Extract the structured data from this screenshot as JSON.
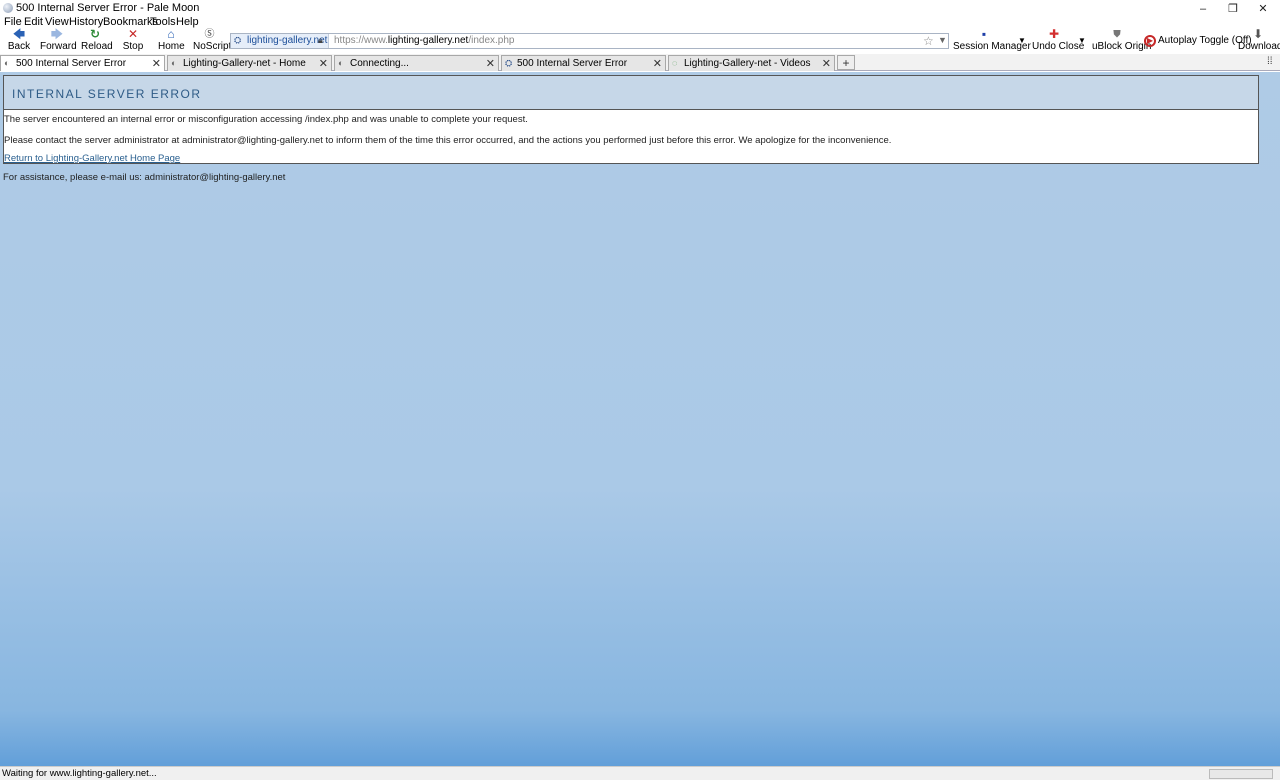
{
  "window": {
    "title": "500 Internal Server Error - Pale Moon",
    "minimize": "–",
    "maximize": "❐",
    "close": "✕"
  },
  "menubar": {
    "items": [
      "File",
      "Edit",
      "View",
      "History",
      "Bookmarks",
      "Tools",
      "Help"
    ]
  },
  "toolbar": {
    "back": "Back",
    "forward": "Forward",
    "reload": "Reload",
    "stop": "Stop",
    "home": "Home",
    "noscript": "NoScript",
    "session_manager": "Session Manager",
    "undo_close": "Undo Close",
    "ublock": "uBlock Origin",
    "autoplay": "Autoplay Toggle (Off)",
    "downloads": "Downloads",
    "icons": {
      "back": "back-arrow-icon",
      "forward": "forward-arrow-icon",
      "reload": "reload-icon",
      "stop": "stop-icon",
      "home": "home-icon",
      "noscript": "noscript-icon",
      "session_manager": "save-icon",
      "undo_close": "undo-close-icon",
      "ublock": "ublock-icon",
      "autoplay": "autoplay-icon",
      "downloads": "download-icon"
    },
    "colors": {
      "back": "#2b62b5",
      "forward": "#9bb7e0",
      "reload": "#2d8a37",
      "stop": "#c62828",
      "home": "#2b62b5"
    }
  },
  "urlbar": {
    "identity_label": "lighting-gallery.net",
    "url_prefix": "https://www.",
    "url_domain": "lighting-gallery.net",
    "url_path": "/index.php"
  },
  "tabs": [
    {
      "label": "500 Internal Server Error",
      "active": true
    },
    {
      "label": "Lighting-Gallery-net - Home",
      "active": false
    },
    {
      "label": "Connecting...",
      "active": false
    },
    {
      "label": "500 Internal Server Error",
      "active": false
    },
    {
      "label": "Lighting-Gallery-net - Videos",
      "active": false
    }
  ],
  "page": {
    "heading": "INTERNAL SERVER ERROR",
    "paragraph1": "The server encountered an internal error or misconfiguration accessing /index.php and was unable to complete your request.",
    "paragraph2": "Please contact the server administrator at administrator@lighting-gallery.net to inform them of the time this error occurred, and the actions you performed just before this error. We apologize for the inconvenience.",
    "return_link": "Return to Lighting-Gallery.net Home Page",
    "assistance": "For assistance, please e-mail us: administrator@lighting-gallery.net"
  },
  "statusbar": {
    "text": "Waiting for www.lighting-gallery.net..."
  }
}
